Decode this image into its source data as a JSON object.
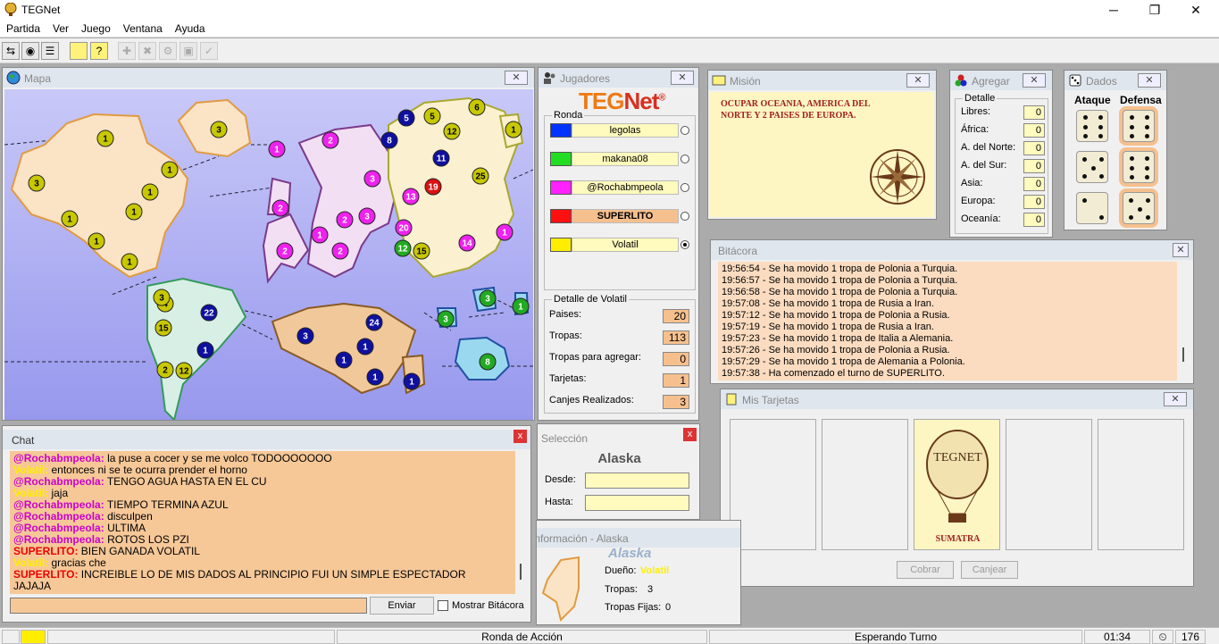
{
  "window": {
    "title": "TEGNet",
    "buttons": [
      "minimize",
      "restore",
      "close"
    ]
  },
  "menu": [
    "Partida",
    "Ver",
    "Juego",
    "Ventana",
    "Ayuda"
  ],
  "toolbar": [
    "connect-icon",
    "globe-icon",
    "list-icon",
    "card-icon",
    "card2-icon",
    "add-icon",
    "delete-icon",
    "gear-icon",
    "copy-icon",
    "check-icon"
  ],
  "mapa": {
    "title": "Mapa",
    "close": "✕"
  },
  "jugadores": {
    "title": "Jugadores",
    "logo_teg": "TEG",
    "logo_net": "Net",
    "logo_reg": "®",
    "ronda_label": "Ronda",
    "players": [
      {
        "name": "legolas",
        "color": "#0033ff",
        "selected": false
      },
      {
        "name": "makana08",
        "color": "#22dd22",
        "selected": false
      },
      {
        "name": "@Rochabmpeola",
        "color": "#ff22ff",
        "selected": false
      },
      {
        "name": "SUPERLITO",
        "color": "#ff1111",
        "selected": false,
        "active": true
      },
      {
        "name": "Volatil",
        "color": "#ffee00",
        "selected": true
      }
    ],
    "detalle_label": "Detalle de Volatil",
    "detalle": [
      {
        "label": "Paises:",
        "value": "20"
      },
      {
        "label": "Tropas:",
        "value": "113"
      },
      {
        "label": "Tropas para agregar:",
        "value": "0"
      },
      {
        "label": "Tarjetas:",
        "value": "1"
      },
      {
        "label": "Canjes Realizados:",
        "value": "3"
      }
    ]
  },
  "mision": {
    "title": "Misión",
    "text": "OCUPAR OCEANIA, AMERICA DEL NORTE Y 2 PAISES DE EUROPA."
  },
  "agregar": {
    "title": "Agregar",
    "detalle_label": "Detalle",
    "rows": [
      {
        "label": "Libres:",
        "value": "0"
      },
      {
        "label": "África:",
        "value": "0"
      },
      {
        "label": "A. del Norte:",
        "value": "0"
      },
      {
        "label": "A. del Sur:",
        "value": "0"
      },
      {
        "label": "Asia:",
        "value": "0"
      },
      {
        "label": "Europa:",
        "value": "0"
      },
      {
        "label": "Oceanía:",
        "value": "0"
      }
    ]
  },
  "dados": {
    "title": "Dados",
    "ataque": "Ataque",
    "defensa": "Defensa",
    "attack": [
      6,
      5,
      2
    ],
    "defense": [
      6,
      6,
      5
    ]
  },
  "bitacora": {
    "title": "Bitácora",
    "lines": [
      "19:56:54 - Se ha movido 1 tropa de Polonia a Turquia.",
      "19:56:57 - Se ha movido 1 tropa de Polonia a Turquia.",
      "19:56:58 - Se ha movido 1 tropa de Polonia a Turquia.",
      "19:57:08 - Se ha movido 1 tropa de Rusia a Iran.",
      "19:57:12 - Se ha movido 1 tropa de Polonia a Rusia.",
      "19:57:19 - Se ha movido 1 tropa de Rusia a Iran.",
      "19:57:23 - Se ha movido 1 tropa de Italia a Alemania.",
      "19:57:26 - Se ha movido 1 tropa de Polonia a Rusia.",
      "19:57:29 - Se ha movido 1 tropa de Alemania a Polonia.",
      "19:57:38 - Ha comenzado el turno de SUPERLITO."
    ]
  },
  "tarjetas": {
    "title": "Mis Tarjetas",
    "card_logo": "TEGNET",
    "card_name": "SUMATRA",
    "cobrar": "Cobrar",
    "canjear": "Canjear"
  },
  "chat": {
    "title": "Chat",
    "lines": [
      {
        "nick": "@Rochabmpeola:",
        "color": "#cc00cc",
        "msg": "la puse a cocer y se me volco TODOOOOOOO"
      },
      {
        "nick": "Volatil:",
        "color": "#ffee00",
        "msg": "entonces ni se te ocurra prender el horno"
      },
      {
        "nick": "@Rochabmpeola:",
        "color": "#cc00cc",
        "msg": "TENGO AGUA HASTA EN EL CU"
      },
      {
        "nick": "Volatil:",
        "color": "#ffee00",
        "msg": "jaja"
      },
      {
        "nick": "@Rochabmpeola:",
        "color": "#cc00cc",
        "msg": "TIEMPO TERMINA AZUL"
      },
      {
        "nick": "@Rochabmpeola:",
        "color": "#cc00cc",
        "msg": "disculpen"
      },
      {
        "nick": "@Rochabmpeola:",
        "color": "#cc00cc",
        "msg": "ULTIMA"
      },
      {
        "nick": "@Rochabmpeola:",
        "color": "#cc00cc",
        "msg": "ROTOS LOS PZI"
      },
      {
        "nick": "SUPERLITO:",
        "color": "#ee0000",
        "msg": "BIEN GANADA VOLATIL"
      },
      {
        "nick": "Volatil:",
        "color": "#ffee00",
        "msg": "gracias che"
      },
      {
        "nick": "SUPERLITO:",
        "color": "#ee0000",
        "msg": "INCREIBLE LO DE MIS DADOS AL PRINCIPIO FUI UN SIMPLE ESPECTADOR"
      },
      {
        "nick": "",
        "color": "#000",
        "msg": "JAJAJA"
      }
    ],
    "input_value": "",
    "enviar": "Enviar",
    "mostrar": "Mostrar Bitácora"
  },
  "seleccion": {
    "title": "Selección",
    "country": "Alaska",
    "desde": "Desde:",
    "hasta": "Hasta:"
  },
  "informacion": {
    "title": "Información - Alaska",
    "country": "Alaska",
    "dueno_label": "Dueño:",
    "dueno": "Volatil",
    "tropas_label": "Tropas:",
    "tropas": "3",
    "fijas_label": "Tropas Fijas:",
    "fijas": "0"
  },
  "statusbar": {
    "phase": "Ronda de Acción",
    "state": "Esperando Turno",
    "time": "01:34",
    "count": "176"
  },
  "map_armies": [
    {
      "n": "1",
      "c": "#c8c800"
    },
    {
      "n": "3",
      "c": "#c8c800"
    },
    {
      "n": "1",
      "c": "#c8c800"
    },
    {
      "n": "1",
      "c": "#c8c800"
    },
    {
      "n": "3",
      "c": "#c8c800"
    },
    {
      "n": "1",
      "c": "#c8c800"
    },
    {
      "n": "1",
      "c": "#c8c800"
    },
    {
      "n": "1",
      "c": "#c8c800"
    },
    {
      "n": "1",
      "c": "#c8c800"
    },
    {
      "n": "4",
      "c": "#c8c800"
    },
    {
      "n": "3",
      "c": "#c8c800"
    },
    {
      "n": "22",
      "c": "#1010a0"
    },
    {
      "n": "15",
      "c": "#c8c800"
    },
    {
      "n": "1",
      "c": "#1010a0"
    },
    {
      "n": "2",
      "c": "#c8c800"
    },
    {
      "n": "12",
      "c": "#c8c800"
    },
    {
      "n": "1",
      "c": "#ee22ee"
    },
    {
      "n": "2",
      "c": "#ee22ee"
    },
    {
      "n": "2",
      "c": "#ee22ee"
    },
    {
      "n": "3",
      "c": "#ee22ee"
    },
    {
      "n": "13",
      "c": "#ee22ee"
    },
    {
      "n": "2",
      "c": "#ee22ee"
    },
    {
      "n": "3",
      "c": "#ee22ee"
    },
    {
      "n": "1",
      "c": "#ee22ee"
    },
    {
      "n": "2",
      "c": "#ee22ee"
    },
    {
      "n": "2",
      "c": "#ee22ee"
    },
    {
      "n": "20",
      "c": "#ee22ee"
    },
    {
      "n": "14",
      "c": "#ee22ee"
    },
    {
      "n": "1",
      "c": "#ee22ee"
    },
    {
      "n": "5",
      "c": "#1010a0"
    },
    {
      "n": "5",
      "c": "#c8c800"
    },
    {
      "n": "6",
      "c": "#c8c800"
    },
    {
      "n": "1",
      "c": "#c8c800"
    },
    {
      "n": "8",
      "c": "#1010a0"
    },
    {
      "n": "12",
      "c": "#c8c800"
    },
    {
      "n": "11",
      "c": "#1010a0"
    },
    {
      "n": "19",
      "c": "#dd1111"
    },
    {
      "n": "25",
      "c": "#c8c800"
    },
    {
      "n": "12",
      "c": "#22aa22"
    },
    {
      "n": "15",
      "c": "#c8c800"
    },
    {
      "n": "3",
      "c": "#1010a0"
    },
    {
      "n": "24",
      "c": "#1010a0"
    },
    {
      "n": "1",
      "c": "#1010a0"
    },
    {
      "n": "1",
      "c": "#1010a0"
    },
    {
      "n": "1",
      "c": "#1010a0"
    },
    {
      "n": "1",
      "c": "#1010a0"
    },
    {
      "n": "3",
      "c": "#22aa22"
    },
    {
      "n": "3",
      "c": "#22aa22"
    },
    {
      "n": "1",
      "c": "#22aa22"
    },
    {
      "n": "8",
      "c": "#22aa22"
    }
  ]
}
